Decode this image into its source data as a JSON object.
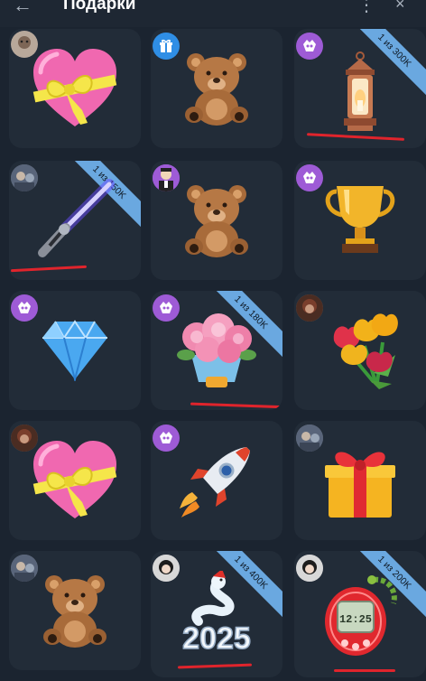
{
  "header": {
    "back_icon": "←",
    "title": "Подарки",
    "menu_icon": "⋮",
    "close_icon": "×"
  },
  "gifts": [
    {
      "art": "heart-bow",
      "avatar": "photo-hamster",
      "ribbon": ""
    },
    {
      "art": "teddy-bear",
      "avatar": "gift-blue",
      "ribbon": ""
    },
    {
      "art": "lantern",
      "avatar": "purple-mask",
      "ribbon": "1 из 300K"
    },
    {
      "art": "lightsaber",
      "avatar": "photo-group",
      "ribbon": "1 из 150K"
    },
    {
      "art": "teddy-bear",
      "avatar": "photo-man",
      "ribbon": ""
    },
    {
      "art": "trophy",
      "avatar": "purple-mask",
      "ribbon": ""
    },
    {
      "art": "diamond",
      "avatar": "purple-mask",
      "ribbon": ""
    },
    {
      "art": "peonies",
      "avatar": "purple-mask",
      "ribbon": "1 из 180K"
    },
    {
      "art": "tulips",
      "avatar": "photo-dark",
      "ribbon": ""
    },
    {
      "art": "heart-bow",
      "avatar": "photo-dark",
      "ribbon": ""
    },
    {
      "art": "rocket",
      "avatar": "purple-mask",
      "ribbon": ""
    },
    {
      "art": "gift-box",
      "avatar": "photo-group",
      "ribbon": ""
    },
    {
      "art": "teddy-bear",
      "avatar": "photo-group",
      "ribbon": ""
    },
    {
      "art": "snake-2025",
      "avatar": "photo-girl",
      "ribbon": "1 из 400K"
    },
    {
      "art": "tamagotchi",
      "avatar": "photo-girl",
      "ribbon": "1 из 200K"
    }
  ],
  "snake_text": "2025",
  "tamagotchi_screen": "12:25",
  "colors": {
    "background": "#1b2430",
    "cell": "#222c38",
    "ribbon": "#6aa8e0",
    "underline": "#e0242c",
    "purple": "#9e5bd6"
  }
}
